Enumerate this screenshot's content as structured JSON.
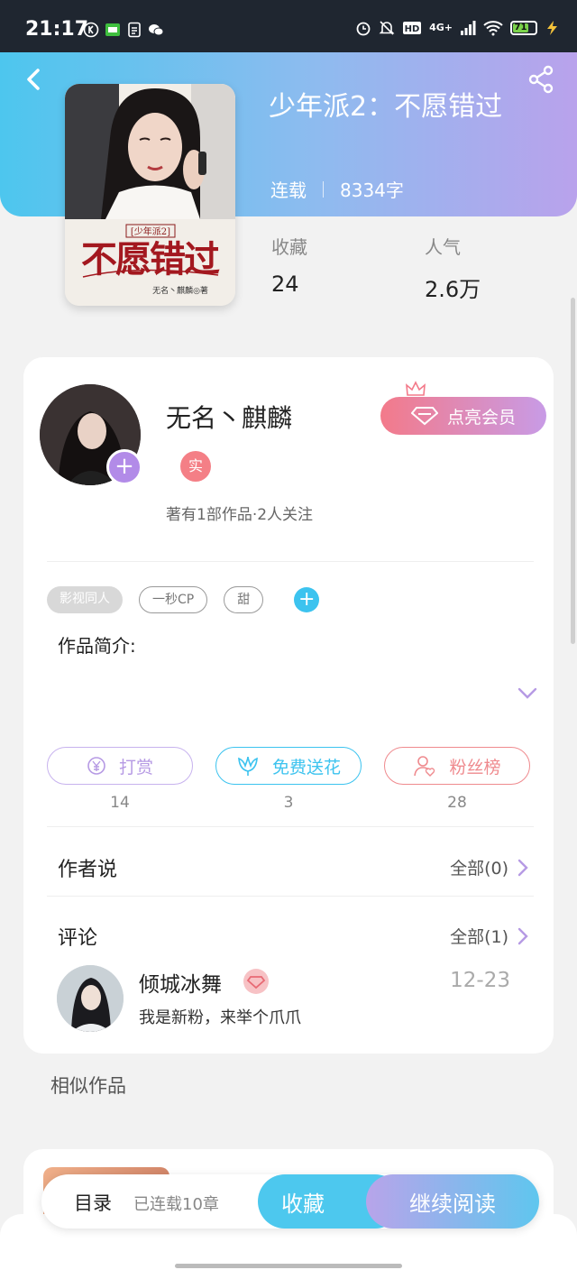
{
  "status_bar": {
    "time": "21:17",
    "network": "4G+",
    "battery": "71",
    "battery_level": 0.71,
    "left_icons": [
      "k-circle-icon",
      "wechat-pay-icon",
      "document-icon",
      "wechat-icon"
    ],
    "right_icons": [
      "alarm-icon",
      "mute-icon",
      "hd-icon",
      "signal-icon",
      "wifi-icon",
      "battery-icon",
      "charging-icon"
    ]
  },
  "book": {
    "title": "少年派2：不愿错过",
    "status": "连载",
    "word_count": "8334字",
    "stats": [
      {
        "label": "收藏",
        "value": "24"
      },
      {
        "label": "人气",
        "value": "2.6万"
      }
    ],
    "cover": {
      "series_tag": "[少年派2]",
      "title_art": "不愿错过",
      "author_line": "无名丶麒麟◎著"
    }
  },
  "author": {
    "name": "无名丶麒麟",
    "badge": "实",
    "info": "著有1部作品·2人关注",
    "vip_button": "点亮会员"
  },
  "tags": [
    "影视同人",
    "一秒CP",
    "甜"
  ],
  "intro": {
    "label": "作品简介:"
  },
  "actions": [
    {
      "label": "打赏",
      "count": "14",
      "color": "#b69ae4",
      "icon": "yuan-icon"
    },
    {
      "label": "免费送花",
      "count": "3",
      "color": "#3cc3ef",
      "icon": "flower-icon"
    },
    {
      "label": "粉丝榜",
      "count": "28",
      "color": "#ef8a8e",
      "icon": "fans-icon"
    }
  ],
  "author_says": {
    "title": "作者说",
    "more": "全部(0)"
  },
  "comments": {
    "title": "评论",
    "more": "全部(1)",
    "items": [
      {
        "user": "倾城冰舞",
        "date": "12-23",
        "text": "我是新粉，来举个爪爪"
      }
    ]
  },
  "similar": {
    "title": "相似作品"
  },
  "bottom_bar": {
    "catalog": "目录",
    "chapters": "已连载10章",
    "collect": "收藏",
    "continue": "继续阅读"
  }
}
